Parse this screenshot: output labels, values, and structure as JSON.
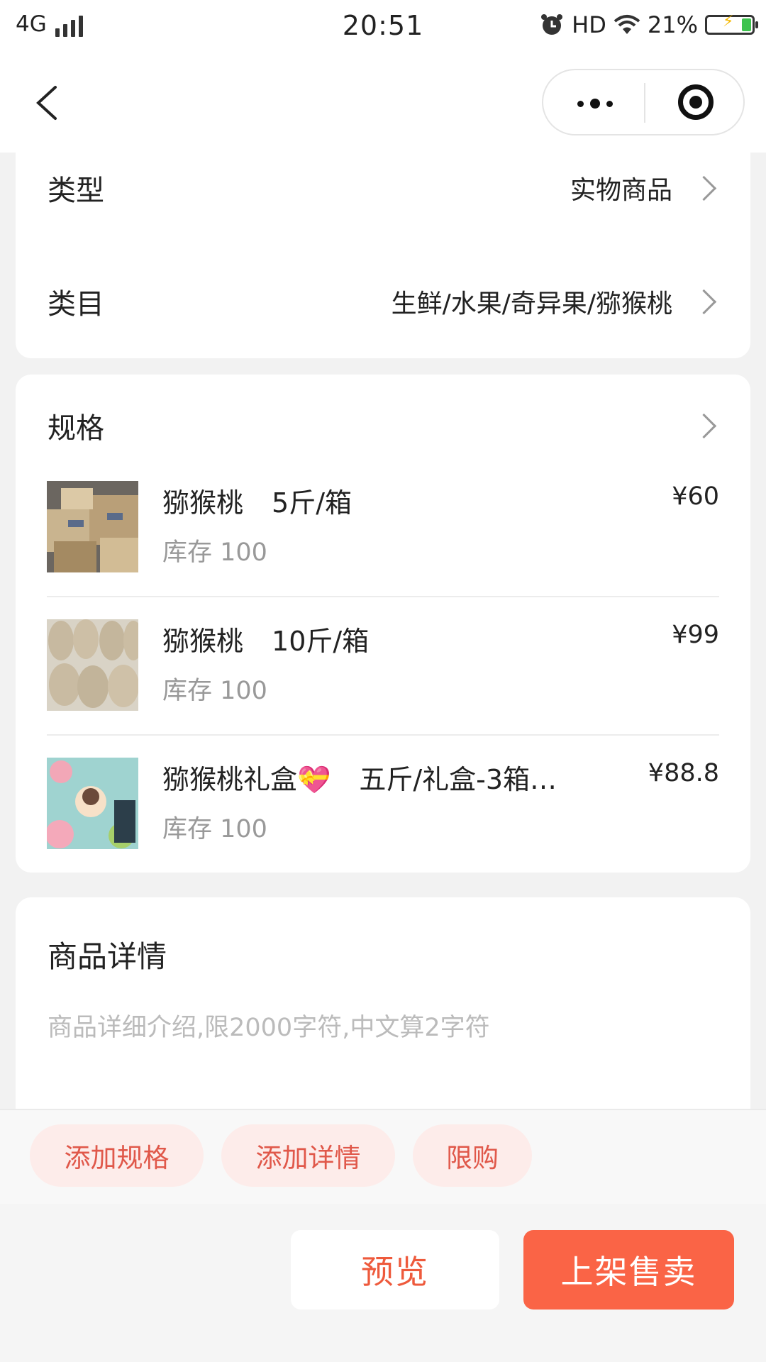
{
  "status_bar": {
    "network": "4G",
    "time": "20:51",
    "hd": "HD",
    "battery": "21%"
  },
  "basic": {
    "type_label": "类型",
    "type_value": "实物商品",
    "category_label": "类目",
    "category_value": "生鲜/水果/奇异果/猕猴桃"
  },
  "specs": {
    "title": "规格",
    "items": [
      {
        "name": "猕猴桃",
        "spec": "5斤/箱",
        "stock": "库存 100",
        "price": "¥60"
      },
      {
        "name": "猕猴桃",
        "spec": "10斤/箱",
        "stock": "库存 100",
        "price": "¥99"
      },
      {
        "name": "猕猴桃礼盒💝",
        "spec": "五斤/礼盒-3箱…",
        "stock": "库存 100",
        "price": "¥88.8"
      }
    ]
  },
  "detail": {
    "title": "商品详情",
    "placeholder": "商品详细介绍,限2000字符,中文算2字符"
  },
  "toolbar": {
    "add_spec": "添加规格",
    "add_detail": "添加详情",
    "limit": "限购"
  },
  "actions": {
    "preview": "预览",
    "publish": "上架售卖"
  },
  "colors": {
    "accent": "#fa6446",
    "pill_bg": "#fdecea",
    "pill_text": "#e0584a"
  }
}
